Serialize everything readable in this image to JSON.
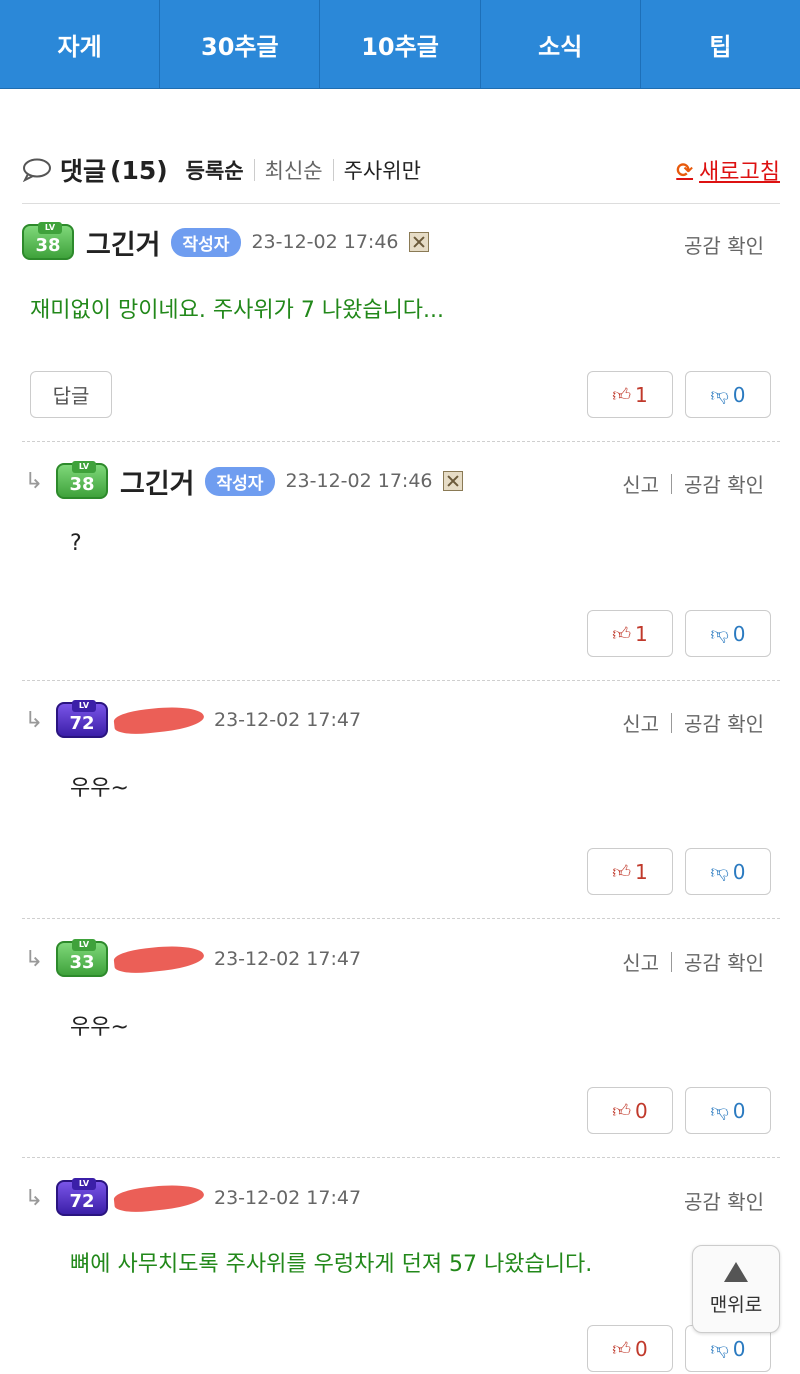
{
  "nav": {
    "items": [
      {
        "label": "자게"
      },
      {
        "label": "30추글"
      },
      {
        "label": "10추글"
      },
      {
        "label": "소식"
      },
      {
        "label": "팁"
      }
    ]
  },
  "comments_header": {
    "title": "댓글",
    "count": "(15)",
    "sort_options": [
      "등록순",
      "최신순",
      "주사위만"
    ],
    "refresh_label": "새로고침"
  },
  "comments": [
    {
      "level": "38",
      "nickname": "그긴거",
      "badge": "작성자",
      "date": "23-12-02 17:46",
      "actions": [
        "공감 확인"
      ],
      "text": "재미없이 망이네요. 주사위가 7 나왔습니다...",
      "reply_button": "답글",
      "likes": "1",
      "dislikes": "0"
    },
    {
      "level": "38",
      "nickname": "그긴거",
      "badge": "작성자",
      "date": "23-12-02 17:46",
      "actions": [
        "신고",
        "공감 확인"
      ],
      "text": "?",
      "likes": "1",
      "dislikes": "0"
    },
    {
      "level": "72",
      "date": "23-12-02 17:47",
      "actions": [
        "신고",
        "공감 확인"
      ],
      "text": "우우~",
      "likes": "1",
      "dislikes": "0"
    },
    {
      "level": "33",
      "date": "23-12-02 17:47",
      "actions": [
        "신고",
        "공감 확인"
      ],
      "text": "우우~",
      "likes": "0",
      "dislikes": "0"
    },
    {
      "level": "72",
      "date": "23-12-02 17:47",
      "actions": [
        "공감 확인"
      ],
      "text": "뼈에 사무치도록 주사위를 우렁차게 던져 57 나왔습니다.",
      "likes": "0",
      "dislikes": "0"
    }
  ],
  "scroll_top_label": "맨위로",
  "lv_tag": "LV",
  "icons": {
    "comment": "speech-bubble-icon",
    "refresh": "refresh-icon",
    "reply": "reply-arrow-icon",
    "like": "thumbs-up-icon",
    "dislike": "thumbs-down-icon",
    "up": "arrow-up-icon"
  },
  "colors": {
    "nav_bg": "#2b88d8",
    "author_text": "#22881a",
    "like": "#c0392b",
    "dislike": "#2a7ac0",
    "refresh": "#d11111"
  }
}
